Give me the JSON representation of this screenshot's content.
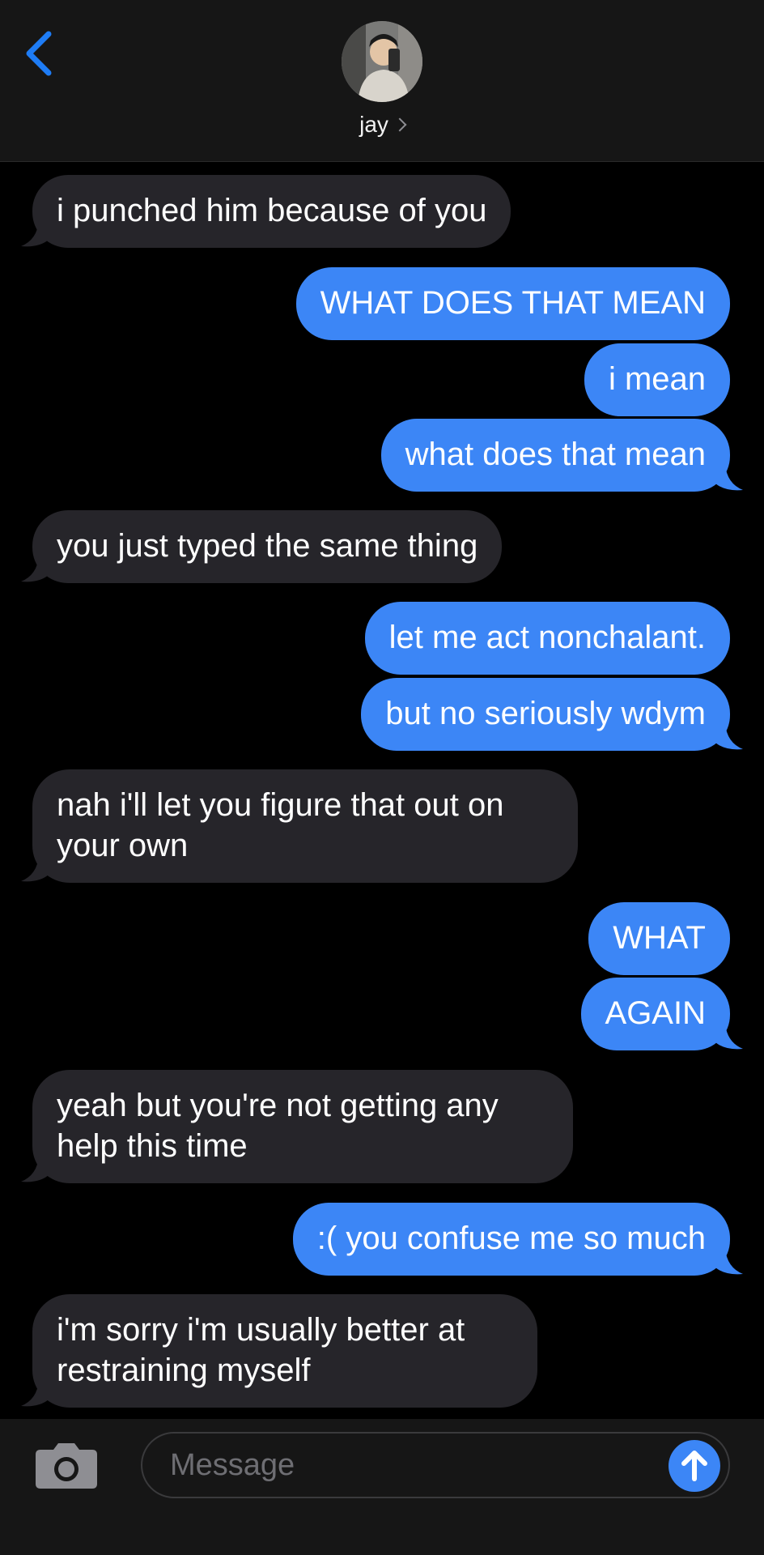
{
  "header": {
    "contact_name": "jay"
  },
  "messages": [
    {
      "side": "in",
      "text": "i punched him because of you"
    },
    {
      "side": "out",
      "text": "WHAT DOES THAT MEAN"
    },
    {
      "side": "out",
      "text": "i mean"
    },
    {
      "side": "out",
      "text": "what does that mean"
    },
    {
      "side": "in",
      "text": "you just typed the same thing"
    },
    {
      "side": "out",
      "text": "let me act nonchalant."
    },
    {
      "side": "out",
      "text": "but no seriously wdym"
    },
    {
      "side": "in",
      "text": "nah i'll let you figure that out on your own"
    },
    {
      "side": "out",
      "text": "WHAT"
    },
    {
      "side": "out",
      "text": "AGAIN"
    },
    {
      "side": "in",
      "text": "yeah but you're not getting any help this time"
    },
    {
      "side": "out",
      "text": ":( you confuse me so much"
    },
    {
      "side": "in",
      "text": "i'm sorry i'm usually better at restraining myself"
    }
  ],
  "composer": {
    "placeholder": "Message"
  },
  "colors": {
    "outgoing_bubble": "#3c86f6",
    "incoming_bubble": "#26252a",
    "accent": "#1e7cf5"
  }
}
